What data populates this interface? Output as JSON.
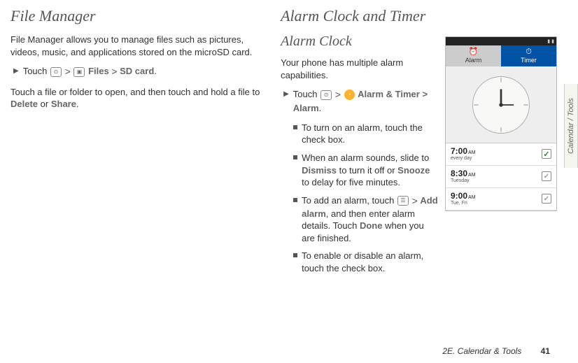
{
  "left": {
    "heading": "File Manager",
    "intro": "File Manager allows you to manage files such as pictures, videos, music, and applications stored on the microSD card.",
    "step_prefix": "Touch ",
    "files_label": "Files",
    "sd_label": "SD card",
    "para2": "Touch a file or folder to open, and then touch and hold a file to ",
    "delete": "Delete",
    "or": " or ",
    "share": "Share"
  },
  "right": {
    "heading": "Alarm Clock and Timer",
    "sub": "Alarm Clock",
    "intro": "Your phone has multiple alarm capabilities.",
    "step_prefix": "Touch ",
    "alarm_timer": "Alarm & Timer",
    "gt": " > ",
    "alarm_bold": "Alarm",
    "bullets": {
      "b1": "To turn on an alarm, touch the check box.",
      "b2a": "When an alarm sounds, slide to ",
      "dismiss": "Dismiss",
      "b2b": " to turn it off or ",
      "snooze": "Snooze",
      "b2c": " to delay for five minutes.",
      "b3a": "To add an alarm, touch ",
      "add_alarm": "Add alarm",
      "b3b": ", and then enter alarm details. Touch ",
      "done": "Done",
      "b3c": " when you are finished.",
      "b4": "To enable or disable an alarm, touch the check box."
    }
  },
  "phone": {
    "tab_alarm": "Alarm",
    "tab_timer": "Timer",
    "alarms": [
      {
        "time": "7:00",
        "ampm": "AM",
        "repeat": "every day",
        "checked": true
      },
      {
        "time": "8:30",
        "ampm": "AM",
        "repeat": "Tuesday",
        "checked": false
      },
      {
        "time": "9:00",
        "ampm": "AM",
        "repeat": "Tue, Fri",
        "checked": false
      }
    ]
  },
  "footer": {
    "section": "2E. Calendar & Tools",
    "page": "41"
  },
  "side_tab": "Calendar / Tools"
}
